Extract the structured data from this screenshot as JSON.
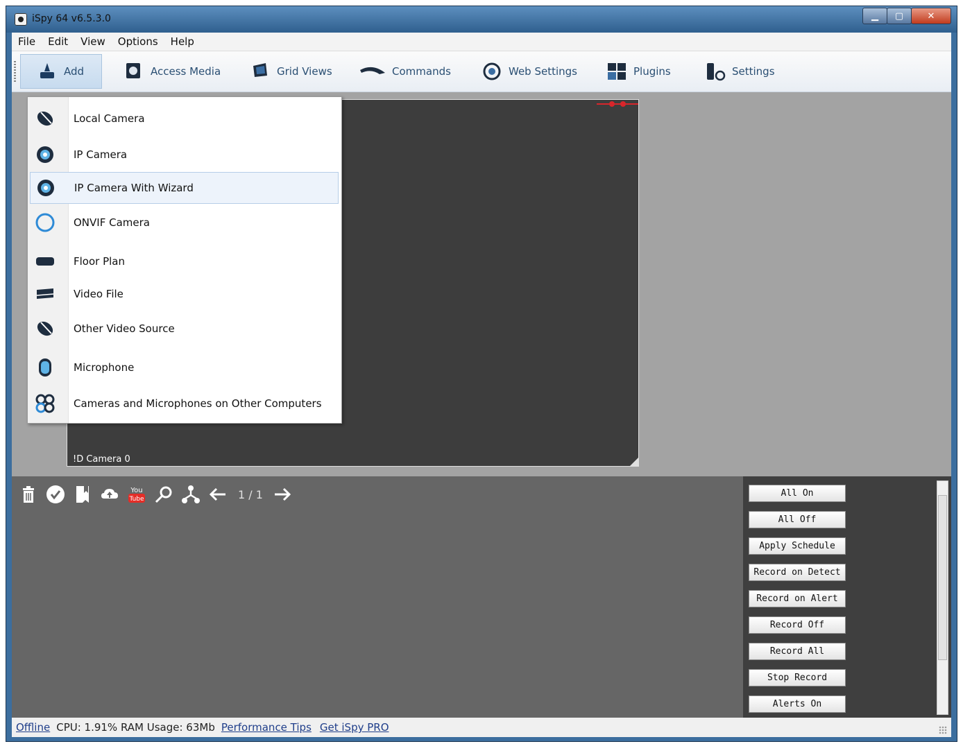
{
  "window": {
    "title": "iSpy 64 v6.5.3.0",
    "controls": [
      "minimize",
      "maximize",
      "close"
    ]
  },
  "menu": [
    "File",
    "Edit",
    "View",
    "Options",
    "Help"
  ],
  "toolbar": [
    {
      "label": "Add",
      "icon": "add-icon",
      "active": true
    },
    {
      "label": "Access Media",
      "icon": "access-media-icon"
    },
    {
      "label": "Grid Views",
      "icon": "grid-views-icon"
    },
    {
      "label": "Commands",
      "icon": "commands-icon"
    },
    {
      "label": "Web Settings",
      "icon": "web-settings-icon"
    },
    {
      "label": "Plugins",
      "icon": "plugins-icon"
    },
    {
      "label": "Settings",
      "icon": "settings-icon"
    }
  ],
  "add_menu": [
    {
      "label": "Local Camera",
      "icon": "local-camera-icon"
    },
    {
      "label": "IP Camera",
      "icon": "ip-camera-icon"
    },
    {
      "label": "IP Camera With Wizard",
      "icon": "ip-camera-wizard-icon",
      "highlighted": true
    },
    {
      "label": "ONVIF Camera",
      "icon": "onvif-camera-icon"
    },
    {
      "label": "Floor Plan",
      "icon": "floor-plan-icon"
    },
    {
      "label": "Video File",
      "icon": "video-file-icon"
    },
    {
      "label": "Other Video Source",
      "icon": "other-video-source-icon"
    },
    {
      "label": "Microphone",
      "icon": "microphone-icon"
    },
    {
      "label": "Cameras and Microphones on Other Computers",
      "icon": "remote-devices-icon"
    }
  ],
  "camera": {
    "label": "!D  Camera 0"
  },
  "media_toolbar": {
    "icons": [
      "delete-icon",
      "check-icon",
      "bookmark-icon",
      "cloud-upload-icon",
      "youtube-icon",
      "search-icon",
      "share-icon",
      "previous-icon",
      "next-icon"
    ],
    "page": "1 / 1"
  },
  "commands": [
    "All On",
    "All Off",
    "Apply Schedule",
    "Record on Detect",
    "Record on Alert",
    "Record Off",
    "Record All",
    "Stop Record",
    "Alerts On"
  ],
  "status": {
    "offline": "Offline",
    "stats": "CPU: 1.91% RAM Usage: 63Mb",
    "perf_tips": "Performance Tips",
    "get_pro": "Get iSpy PRO"
  },
  "colors": {
    "accent": "#2a4f73",
    "link": "#1f3e8a",
    "highlight": "#edf3fb"
  }
}
